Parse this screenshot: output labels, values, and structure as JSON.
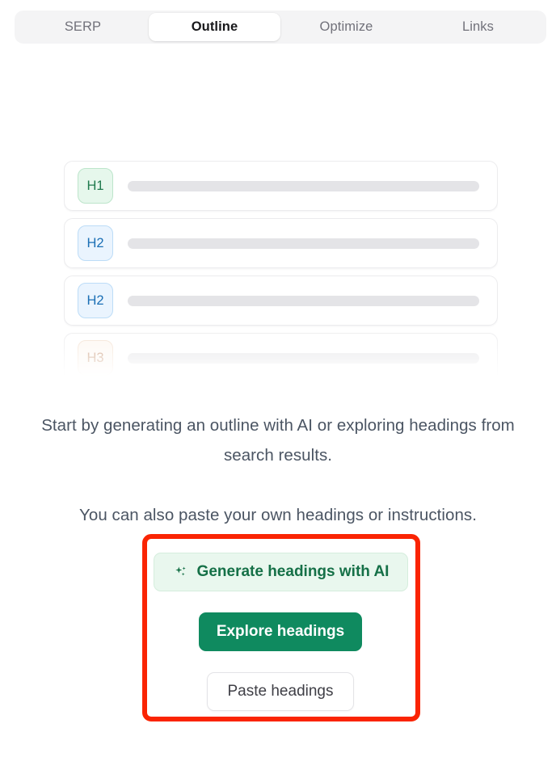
{
  "tabs": [
    {
      "label": "SERP",
      "active": false
    },
    {
      "label": "Outline",
      "active": true
    },
    {
      "label": "Optimize",
      "active": false
    },
    {
      "label": "Links",
      "active": false
    }
  ],
  "outline_preview": {
    "rows": [
      {
        "level": "H1"
      },
      {
        "level": "H2"
      },
      {
        "level": "H2"
      },
      {
        "level": "H3"
      }
    ]
  },
  "copy": {
    "line1": "Start by generating an outline with AI or exploring headings from search results.",
    "line2": "You can also paste your own headings or instructions."
  },
  "actions": {
    "generate": {
      "label": "Generate headings with AI",
      "icon": "sparkles-icon"
    },
    "explore": {
      "label": "Explore headings"
    },
    "paste": {
      "label": "Paste headings"
    }
  },
  "colors": {
    "accent_green": "#0f8a5f",
    "generate_bg": "#e9f7ee",
    "generate_text": "#157047",
    "highlight_red": "#fa2403",
    "tabbar_bg": "#f4f4f5",
    "h1_badge_bg": "#e6f7ec",
    "h2_badge_bg": "#eaf4fe",
    "h3_badge_bg": "#fdf7f1"
  }
}
